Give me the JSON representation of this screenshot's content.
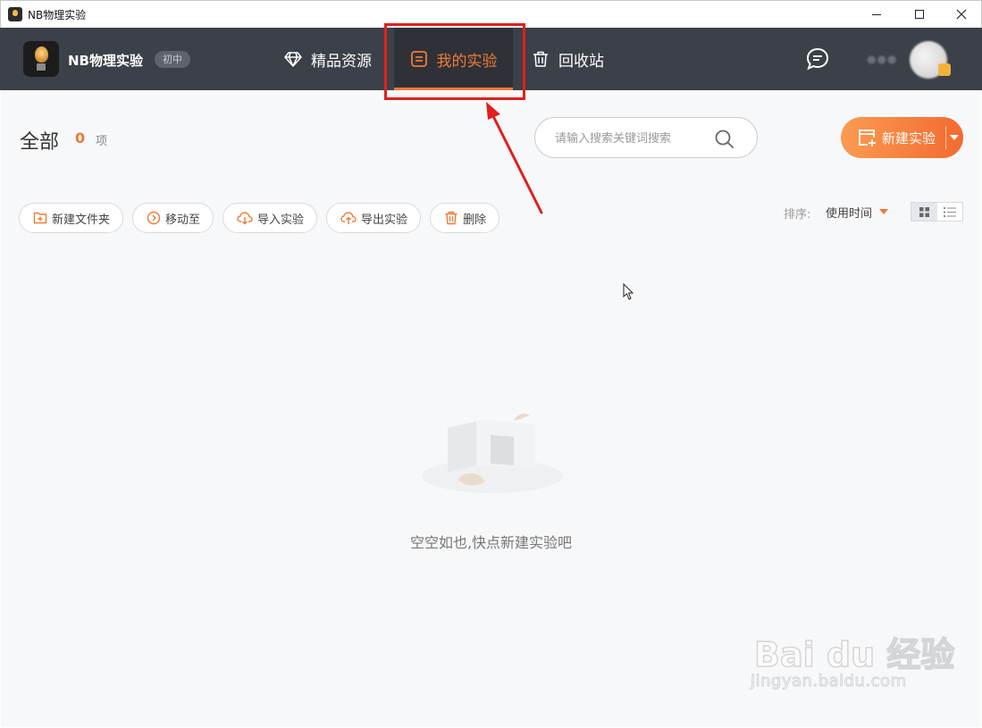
{
  "window": {
    "title": "NB物理实验"
  },
  "navbar": {
    "brand_name": "NB物理实验",
    "level_badge": "初中",
    "tabs": [
      {
        "label": "精品资源",
        "icon": "diamond-icon",
        "active": false
      },
      {
        "label": "我的实验",
        "icon": "document-icon",
        "active": true
      },
      {
        "label": "回收站",
        "icon": "trash-icon",
        "active": false
      }
    ],
    "username": "●●●",
    "accent_color": "#f07a35",
    "bar_color": "#3c4048"
  },
  "main": {
    "title": "全部",
    "count": "0",
    "count_unit": "项",
    "search": {
      "placeholder": "请输入搜索关键词搜索",
      "value": ""
    },
    "new_button_label": "新建实验",
    "toolbar": {
      "new_folder": "新建文件夹",
      "move_to": "移动至",
      "import": "导入实验",
      "export": "导出实验",
      "delete": "删除"
    },
    "sort": {
      "label": "排序:",
      "value": "使用时间"
    },
    "empty_text": "空空如也,快点新建实验吧"
  },
  "watermark": {
    "main": "Bai du 经验",
    "sub": "jingyan.baidu.com"
  }
}
